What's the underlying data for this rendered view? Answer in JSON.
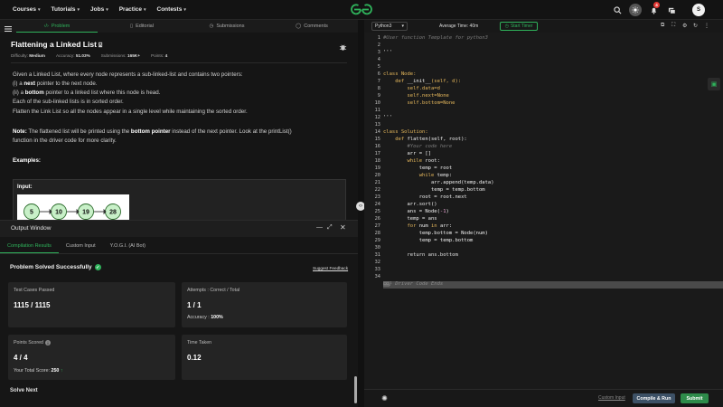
{
  "nav": {
    "items": [
      "Courses",
      "Tutorials",
      "Jobs",
      "Practice",
      "Contests"
    ],
    "notification_count": "4",
    "avatar_letter": "S"
  },
  "left_tabs": [
    "Problem",
    "Editorial",
    "Submissions",
    "Comments"
  ],
  "problem": {
    "title": "Flattening a Linked List",
    "difficulty_label": "Difficulty:",
    "difficulty": "Medium",
    "accuracy_label": "Accuracy:",
    "accuracy": "51.03%",
    "submissions_label": "Submissions:",
    "submissions": "165K+",
    "points_label": "Points:",
    "points": "4",
    "intro": "Given a Linked List, where every node represents a sub-linked-list and contains two pointers:",
    "p1_a": "(i) a ",
    "p1_b": "next",
    "p1_c": " pointer to the next node.",
    "p2_a": "(ii) a ",
    "p2_b": "bottom",
    "p2_c": " pointer to a linked list where this node is head.",
    "p3": "Each of the sub-linked lists is in sorted order.",
    "p4": "Flatten the Link List so all the nodes appear in a single level while maintaining the sorted order.",
    "note_label": "Note:",
    "note_a": " The flattened list will be printed using the ",
    "note_b": "bottom pointer",
    "note_c": " instead of the next pointer. Look at the printList()",
    "note_d": "function in the driver code for more clarity.",
    "examples": "Examples:",
    "input_label": "Input:",
    "example_nodes": [
      "5",
      "10",
      "19",
      "28"
    ]
  },
  "output_window": {
    "title": "Output Window",
    "tabs": [
      "Compilation Results",
      "Custom Input",
      "Y.O.G.I. (AI Bot)"
    ],
    "status": "Problem Solved Successfully",
    "feedback": "Suggest Feedback",
    "cards": {
      "test_label": "Test Cases Passed",
      "test_value": "1115 / 1115",
      "attempts_label": "Attempts : Correct / Total",
      "attempts_value": "1 / 1",
      "accuracy_label": "Accuracy :",
      "accuracy_value": "100%",
      "points_label": "Points Scored",
      "points_value": "4 / 4",
      "total_label": "Your Total Score:",
      "total_value": "250",
      "time_label": "Time Taken",
      "time_value": "0.12"
    },
    "solve_next": "Solve Next"
  },
  "editor": {
    "language": "Python3",
    "average_time": "Average Time: 40m",
    "start_timer": "Start Timer",
    "line_numbers": [
      "1",
      "2",
      "3",
      "4",
      "5",
      "6",
      "7",
      "8",
      "9",
      "10",
      "11",
      "12",
      "13",
      "14",
      "15",
      "16",
      "17",
      "18",
      "19",
      "20",
      "21",
      "22",
      "23",
      "24",
      "25",
      "26",
      "27",
      "28",
      "29",
      "30",
      "31",
      "32",
      "33",
      "34"
    ],
    "lines": {
      "l1": "#User function Template for python3",
      "l3": "'''",
      "l5": "class Node:",
      "l6a": "    def ",
      "l6b": "__init__",
      "l6c": "(self, d):",
      "l7": "        self.data=d",
      "l8": "        self.next=None",
      "l9": "        self.bottom=None",
      "l11": "'''",
      "l13": "class Solution:",
      "l14a": "    def ",
      "l14b": "flatten",
      "l14c": "(self, root):",
      "l15": "        #Your code here",
      "l16": "        arr = []",
      "l17a": "        while ",
      "l17b": "root:",
      "l18": "            temp = root",
      "l19a": "            while ",
      "l19b": "temp:",
      "l20": "                arr.append(temp.data)",
      "l21": "                temp = temp.bottom",
      "l22": "            root = root.next",
      "l23": "        arr.sort()",
      "l24a": "        ans = Node(",
      "l24b": "-1",
      "l24c": ")",
      "l25": "        temp = ans",
      "l26a": "        for ",
      "l26b": "num ",
      "l26c": "in ",
      "l26d": "arr:",
      "l27": "            temp.bottom = Node(num)",
      "l28": "            temp = temp.bottom",
      "l30": "        return ans.bottom",
      "l34": "} Driver Code Ends"
    },
    "custom_input": "Custom Input",
    "compile_run": "Compile & Run",
    "submit": "Submit"
  }
}
